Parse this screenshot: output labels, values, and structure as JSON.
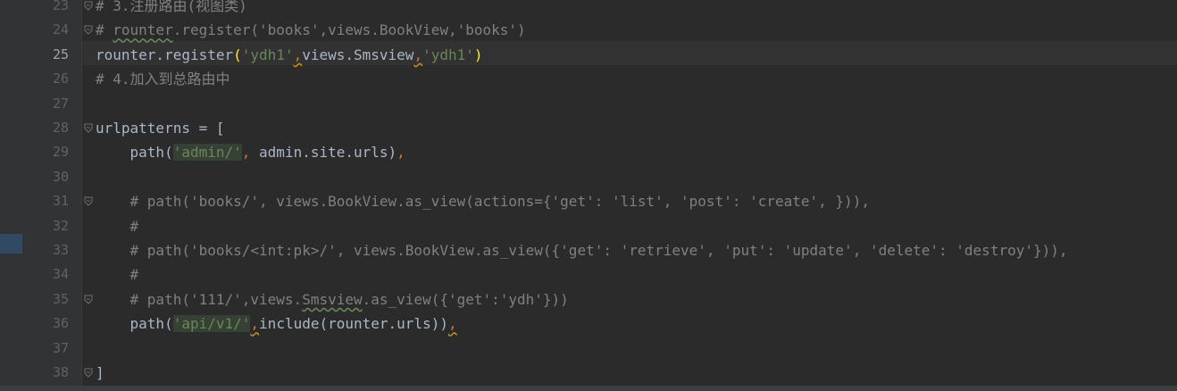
{
  "editor": {
    "current_line": 25,
    "lines": [
      {
        "num": "23",
        "code": "# 3.注册路由(视图类)"
      },
      {
        "num": "24",
        "code": "# rounter.register('books',views.BookView,'books')"
      },
      {
        "num": "25",
        "code": "rounter.register('ydh1',views.Smsview,'ydh1')"
      },
      {
        "num": "26",
        "code": "# 4.加入到总路由中"
      },
      {
        "num": "27",
        "code": ""
      },
      {
        "num": "28",
        "code": "urlpatterns = ["
      },
      {
        "num": "29",
        "code": "    path('admin/', admin.site.urls),"
      },
      {
        "num": "30",
        "code": ""
      },
      {
        "num": "31",
        "code": "    # path('books/', views.BookView.as_view(actions={'get': 'list', 'post': 'create', })),"
      },
      {
        "num": "32",
        "code": "    #"
      },
      {
        "num": "33",
        "code": "    # path('books/<int:pk>/', views.BookView.as_view({'get': 'retrieve', 'put': 'update', 'delete': 'destroy'})),"
      },
      {
        "num": "34",
        "code": "    #"
      },
      {
        "num": "35",
        "code": "    # path('111/',views.Smsview.as_view({'get':'ydh'}))"
      },
      {
        "num": "36",
        "code": "    path('api/v1/',include(rounter.urls)),"
      },
      {
        "num": "37",
        "code": ""
      },
      {
        "num": "38",
        "code": "]"
      }
    ]
  },
  "colors": {
    "background": "#2b2b2b",
    "gutter": "#313335",
    "comment": "#808080",
    "string": "#6a8759",
    "keyword_punct": "#cc7832",
    "text": "#a9b7c6"
  }
}
